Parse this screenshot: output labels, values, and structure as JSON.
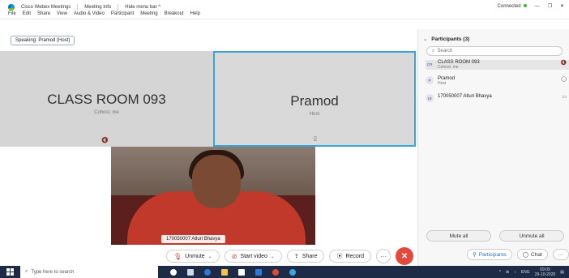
{
  "titlebar": {
    "app_name": "Cisco Webex Meetings",
    "meeting_info": "Meeting Info",
    "hide_menu": "Hide menu bar ^",
    "menu": [
      "File",
      "Edit",
      "Share",
      "View",
      "Audio & Video",
      "Participant",
      "Meeting",
      "Breakout",
      "Help"
    ],
    "status": "Connected",
    "controls": [
      "—",
      "❐",
      "✕"
    ]
  },
  "stage": {
    "speaking": "Speaking: Pramod (Host)",
    "tile_left": {
      "name": "CLASS ROOM 093",
      "role": "Cohost, me",
      "mic": "🔇"
    },
    "tile_right": {
      "name": "Pramod",
      "role": "Host",
      "mic": "▯"
    },
    "video_name": "170050007 Atluri Bhavya"
  },
  "controls": {
    "unmute": "Unmute",
    "start_video": "Start video",
    "share": "Share",
    "record": "Record",
    "more": "···",
    "end": "✕"
  },
  "panel": {
    "title": "Participants (3)",
    "search_placeholder": "Search",
    "participants": [
      {
        "avatar": "CR",
        "name": "CLASS ROOM 093",
        "sub": "Cohost, me",
        "indicator": "🔇"
      },
      {
        "avatar": "P",
        "name": "Pramod",
        "sub": "Host",
        "indicator": "◯"
      },
      {
        "avatar": "18",
        "name": "170050007 Atluri Bhavya",
        "sub": "",
        "indicator": "▭"
      }
    ],
    "mute_all": "Mute all",
    "unmute_all": "Unmute all",
    "tab_participants": "Participants",
    "tab_chat": "Chat",
    "tab_more": "···"
  },
  "taskbar": {
    "search": "Type here to search",
    "tray_lang": "ENG",
    "time": "09:09",
    "date": "29-10-2020"
  },
  "colors": {
    "accent": "#38a6d8",
    "end_call": "#e5483d",
    "taskbar": "#1d2b47"
  }
}
